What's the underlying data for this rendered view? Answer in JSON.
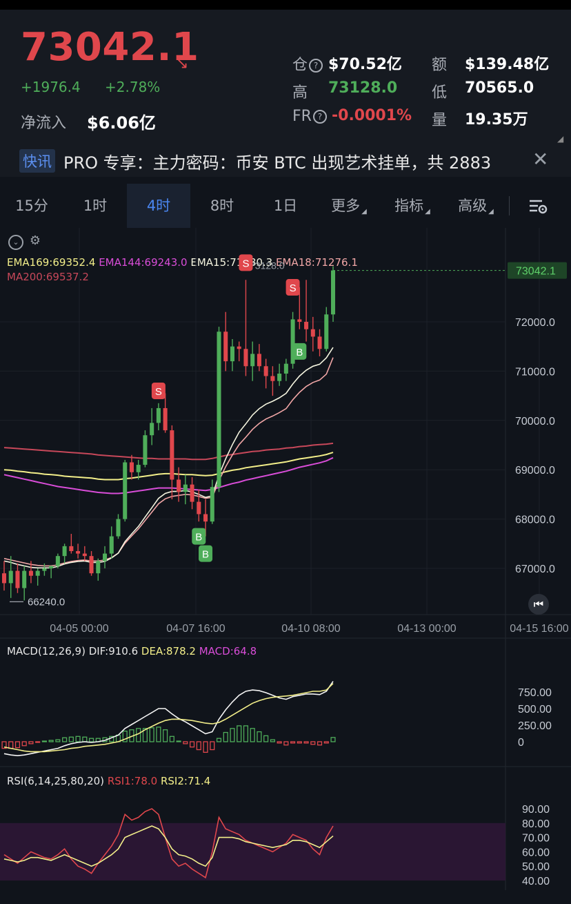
{
  "header": {
    "price": "73042.1",
    "change": "+1976.4",
    "change_pct": "+2.78%",
    "inflow_label": "净流入",
    "inflow_value": "$6.06亿",
    "stats": {
      "oi_label": "仓",
      "oi_value": "$70.52亿",
      "turnover_label": "额",
      "turnover_value": "$139.48亿",
      "high_label": "高",
      "high_value": "73128.0",
      "low_label": "低",
      "low_value": "70565.0",
      "fr_label": "FR",
      "fr_value": "-0.0001%",
      "volume_label": "量",
      "volume_value": "19.35万"
    }
  },
  "news": {
    "tag": "快讯",
    "text": "PRO 专享：主力密码：币安 BTC 出现艺术挂单，共 2883"
  },
  "tabs": [
    {
      "label": "15分"
    },
    {
      "label": "1时"
    },
    {
      "label": "4时"
    },
    {
      "label": "8时"
    },
    {
      "label": "1日"
    },
    {
      "label": "更多"
    },
    {
      "label": "指标"
    },
    {
      "label": "高级"
    }
  ],
  "icons": {
    "settings": "layout-settings-icon",
    "collapse": "chevron-circle-icon",
    "gear": "gear-icon",
    "back": "jump-to-latest-icon",
    "close": "close-icon"
  },
  "colors": {
    "up": "#4fae5a",
    "down": "#e0474c",
    "ema169": "#f3ef8a",
    "ema144": "#d94dd8",
    "ema18_fast": "#f5f5e0",
    "ema18": "#f2a7a7",
    "ma200": "#c8485a",
    "accent": "#4a86f0"
  },
  "main_legend": {
    "ema169": "EMA169:69352.4",
    "ema144": "EMA144:69243.0",
    "ema15": "EMA15:71480.3",
    "ema18": "EMA18:71276.1",
    "ma200": "MA200:69537.2"
  },
  "macd_legend": {
    "name": "MACD(12,26,9)",
    "dif": "DIF:910.6",
    "dea": "DEA:878.2",
    "macd": "MACD:64.8"
  },
  "rsi_legend": {
    "name": "RSI(6,14,25,80,20)",
    "rsi1": "RSI1:78.0",
    "rsi2": "RSI2:71.4"
  },
  "chart_data": {
    "type": "candlestick",
    "price_axis_ticks": [
      72000,
      71000,
      70000,
      69000,
      68000,
      67000
    ],
    "price_axis_labels": [
      "72000.0",
      "71000.0",
      "70000.0",
      "69000.0",
      "68000.0",
      "67000.0"
    ],
    "price_range": [
      66240,
      73400
    ],
    "last_price_label": "73042.1",
    "high_marker_label": "73128.0",
    "low_marker_label": "66240.0",
    "time_ticks": [
      "04-05 00:00",
      "04-07 16:00",
      "04-10 08:00",
      "04-13 00:00",
      "04-15 16:00"
    ],
    "candles": [
      [
        66900,
        67150,
        66550,
        66700
      ],
      [
        66700,
        67250,
        66400,
        66950
      ],
      [
        66950,
        67100,
        66500,
        66600
      ],
      [
        66600,
        67050,
        66350,
        66950
      ],
      [
        66950,
        67150,
        66700,
        66850
      ],
      [
        66850,
        67000,
        66650,
        66950
      ],
      [
        66950,
        67100,
        66850,
        67000
      ],
      [
        67000,
        67050,
        66800,
        67050
      ],
      [
        67050,
        67300,
        67000,
        67250
      ],
      [
        67250,
        67500,
        67100,
        67450
      ],
      [
        67450,
        67700,
        67300,
        67350
      ],
      [
        67350,
        67500,
        67200,
        67300
      ],
      [
        67300,
        67450,
        67150,
        67250
      ],
      [
        67250,
        67350,
        66850,
        66900
      ],
      [
        66900,
        67200,
        66750,
        67150
      ],
      [
        67150,
        67450,
        67000,
        67300
      ],
      [
        67300,
        67850,
        67200,
        67650
      ],
      [
        67650,
        68100,
        67600,
        68000
      ],
      [
        68000,
        69200,
        67950,
        69150
      ],
      [
        69150,
        69300,
        68800,
        68950
      ],
      [
        68950,
        69200,
        68800,
        69100
      ],
      [
        69100,
        69800,
        69050,
        69700
      ],
      [
        69700,
        70250,
        69500,
        69950
      ],
      [
        69950,
        70350,
        69800,
        70250
      ],
      [
        70250,
        70550,
        69750,
        69800
      ],
      [
        69800,
        69900,
        68400,
        68800
      ],
      [
        68800,
        69050,
        68350,
        68550
      ],
      [
        68550,
        68900,
        68300,
        68700
      ],
      [
        68700,
        68850,
        68200,
        68350
      ],
      [
        68350,
        68600,
        67950,
        68100
      ],
      [
        68100,
        68400,
        67650,
        67950
      ],
      [
        67950,
        68800,
        67900,
        68650
      ],
      [
        68650,
        71900,
        68550,
        71800
      ],
      [
        71800,
        72200,
        71000,
        71200
      ],
      [
        71200,
        71650,
        71000,
        71500
      ],
      [
        71500,
        71600,
        71200,
        71450
      ],
      [
        71450,
        72850,
        70900,
        71100
      ],
      [
        71100,
        71600,
        70800,
        71350
      ],
      [
        71350,
        71550,
        71000,
        71100
      ],
      [
        71100,
        71250,
        70650,
        70900
      ],
      [
        70900,
        71100,
        70500,
        70800
      ],
      [
        70800,
        71150,
        70700,
        70950
      ],
      [
        70950,
        71250,
        70800,
        71150
      ],
      [
        71150,
        72200,
        71050,
        72050
      ],
      [
        72050,
        72700,
        71850,
        72000
      ],
      [
        72000,
        72850,
        71600,
        71850
      ],
      [
        71850,
        72100,
        71400,
        71700
      ],
      [
        71700,
        71850,
        71300,
        71450
      ],
      [
        71450,
        72300,
        71400,
        72150
      ],
      [
        72150,
        73128,
        72000,
        73042
      ]
    ],
    "signals": [
      {
        "type": "S",
        "index": 23,
        "price": 70600
      },
      {
        "type": "B",
        "index": 29,
        "price": 67650
      },
      {
        "type": "B",
        "index": 30,
        "price": 67300
      },
      {
        "type": "S",
        "index": 36,
        "price": 73200
      },
      {
        "type": "S",
        "index": 43,
        "price": 72700
      },
      {
        "type": "B",
        "index": 44,
        "price": 71400
      }
    ],
    "series": {
      "ma200": [
        69450,
        69440,
        69430,
        69420,
        69410,
        69400,
        69390,
        69380,
        69370,
        69360,
        69350,
        69340,
        69330,
        69320,
        69300,
        69290,
        69280,
        69270,
        69260,
        69250,
        69240,
        69230,
        69230,
        69220,
        69220,
        69220,
        69220,
        69220,
        69210,
        69210,
        69210,
        69230,
        69260,
        69290,
        69310,
        69330,
        69350,
        69370,
        69380,
        69400,
        69410,
        69420,
        69440,
        69450,
        69470,
        69480,
        69500,
        69510,
        69520,
        69537
      ],
      "ema169": [
        69000,
        68990,
        68970,
        68960,
        68940,
        68930,
        68910,
        68900,
        68890,
        68870,
        68860,
        68850,
        68840,
        68830,
        68810,
        68800,
        68800,
        68800,
        68820,
        68830,
        68850,
        68870,
        68890,
        68910,
        68920,
        68920,
        68910,
        68900,
        68900,
        68890,
        68880,
        68890,
        68920,
        68960,
        68990,
        69010,
        69040,
        69060,
        69080,
        69100,
        69120,
        69140,
        69160,
        69190,
        69220,
        69240,
        69260,
        69280,
        69310,
        69352
      ],
      "ema144": [
        68900,
        68870,
        68840,
        68810,
        68780,
        68750,
        68720,
        68690,
        68660,
        68640,
        68620,
        68600,
        68580,
        68560,
        68540,
        68530,
        68520,
        68520,
        68530,
        68550,
        68570,
        68590,
        68610,
        68630,
        68630,
        68630,
        68620,
        68610,
        68600,
        68590,
        68580,
        68600,
        68640,
        68680,
        68720,
        68750,
        68790,
        68820,
        68850,
        68880,
        68910,
        68940,
        68970,
        69010,
        69050,
        69080,
        69110,
        69140,
        69180,
        69243
      ],
      "ema15": [
        67150,
        67120,
        67080,
        67050,
        67020,
        67010,
        67010,
        67010,
        67040,
        67090,
        67120,
        67140,
        67150,
        67120,
        67120,
        67140,
        67210,
        67310,
        67540,
        67700,
        67850,
        68040,
        68230,
        68420,
        68520,
        68560,
        68560,
        68580,
        68550,
        68500,
        68440,
        68470,
        68890,
        69220,
        69510,
        69760,
        69930,
        70110,
        70240,
        70330,
        70390,
        70460,
        70550,
        70740,
        70900,
        71020,
        71100,
        71140,
        71270,
        71480
      ],
      "ema18": [
        67200,
        67170,
        67140,
        67110,
        67080,
        67060,
        67050,
        67050,
        67070,
        67110,
        67140,
        67160,
        67170,
        67150,
        67150,
        67170,
        67220,
        67310,
        67510,
        67660,
        67800,
        67970,
        68140,
        68310,
        68410,
        68460,
        68480,
        68500,
        68490,
        68460,
        68420,
        68440,
        68780,
        69060,
        69300,
        69510,
        69660,
        69820,
        69940,
        70030,
        70090,
        70160,
        70240,
        70420,
        70570,
        70690,
        70770,
        70820,
        70940,
        71276
      ]
    },
    "macd": {
      "y_ticks": [
        "750.00",
        "500.00",
        "250.00",
        "0"
      ],
      "dif": [
        -180,
        -200,
        -210,
        -200,
        -180,
        -160,
        -140,
        -120,
        -100,
        -60,
        -30,
        -10,
        0,
        -10,
        0,
        20,
        60,
        100,
        200,
        260,
        320,
        380,
        440,
        500,
        500,
        420,
        350,
        300,
        240,
        180,
        120,
        150,
        340,
        480,
        600,
        700,
        760,
        780,
        770,
        740,
        700,
        660,
        640,
        680,
        700,
        720,
        720,
        710,
        760,
        910
      ],
      "dea": [
        -80,
        -100,
        -120,
        -140,
        -150,
        -150,
        -150,
        -140,
        -130,
        -120,
        -100,
        -90,
        -70,
        -60,
        -50,
        -40,
        -20,
        0,
        40,
        80,
        120,
        180,
        230,
        280,
        320,
        340,
        340,
        330,
        320,
        300,
        280,
        270,
        290,
        340,
        400,
        460,
        520,
        580,
        620,
        650,
        670,
        680,
        690,
        700,
        720,
        740,
        760,
        760,
        780,
        878
      ],
      "hist": [
        -100,
        -100,
        -90,
        -60,
        -30,
        -10,
        10,
        20,
        30,
        60,
        70,
        80,
        70,
        50,
        50,
        60,
        80,
        100,
        160,
        180,
        200,
        200,
        210,
        220,
        180,
        80,
        10,
        -30,
        -80,
        -120,
        -160,
        -120,
        50,
        140,
        200,
        240,
        240,
        200,
        150,
        90,
        30,
        -20,
        -50,
        -20,
        -20,
        -20,
        -40,
        -50,
        -20,
        64
      ]
    },
    "rsi": {
      "y_ticks": [
        "90.00",
        "80.00",
        "70.00",
        "60.00",
        "50.00",
        "40.00"
      ],
      "overbought": 80,
      "oversold": 20,
      "rsi1": [
        58,
        55,
        52,
        56,
        60,
        58,
        56,
        55,
        58,
        62,
        55,
        50,
        48,
        45,
        52,
        58,
        64,
        72,
        86,
        82,
        84,
        88,
        90,
        86,
        70,
        55,
        50,
        52,
        48,
        45,
        42,
        60,
        84,
        76,
        74,
        72,
        68,
        66,
        64,
        62,
        60,
        63,
        66,
        72,
        70,
        68,
        62,
        58,
        70,
        78
      ],
      "rsi2": [
        55,
        54,
        53,
        54,
        56,
        56,
        55,
        54,
        56,
        58,
        56,
        54,
        52,
        50,
        52,
        55,
        58,
        62,
        70,
        72,
        74,
        76,
        78,
        76,
        70,
        62,
        58,
        57,
        55,
        52,
        50,
        56,
        70,
        70,
        70,
        69,
        67,
        66,
        65,
        64,
        63,
        64,
        65,
        68,
        68,
        67,
        65,
        63,
        67,
        71
      ]
    }
  }
}
